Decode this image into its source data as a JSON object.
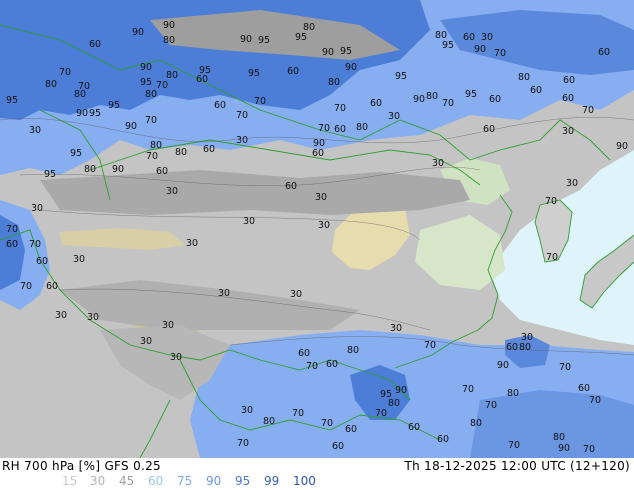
{
  "footer": {
    "left_text": "RH 700 hPa [%] GFS 0.25",
    "right_text": "Th 18-12-2025 12:00 UTC (12+120)"
  },
  "legend": [
    {
      "label": "15",
      "color": "#c8c8c8"
    },
    {
      "label": "30",
      "color": "#b4b4b4"
    },
    {
      "label": "45",
      "color": "#a0a0a0"
    },
    {
      "label": "60",
      "color": "#96c8f0"
    },
    {
      "label": "75",
      "color": "#82aaf0"
    },
    {
      "label": "90",
      "color": "#6e96e6"
    },
    {
      "label": "95",
      "color": "#4678d2"
    },
    {
      "label": "99",
      "color": "#3264be"
    },
    {
      "label": "100",
      "color": "#2850b4"
    }
  ],
  "contour_labels": [
    "90",
    "70",
    "80",
    "60",
    "95",
    "30"
  ],
  "colors": {
    "ocean": "#dff3fb",
    "dry_land": "#bdbdbd",
    "humid": "#86aef0",
    "very_humid": "#4c7ed8",
    "borders": "#2e9e2e"
  }
}
